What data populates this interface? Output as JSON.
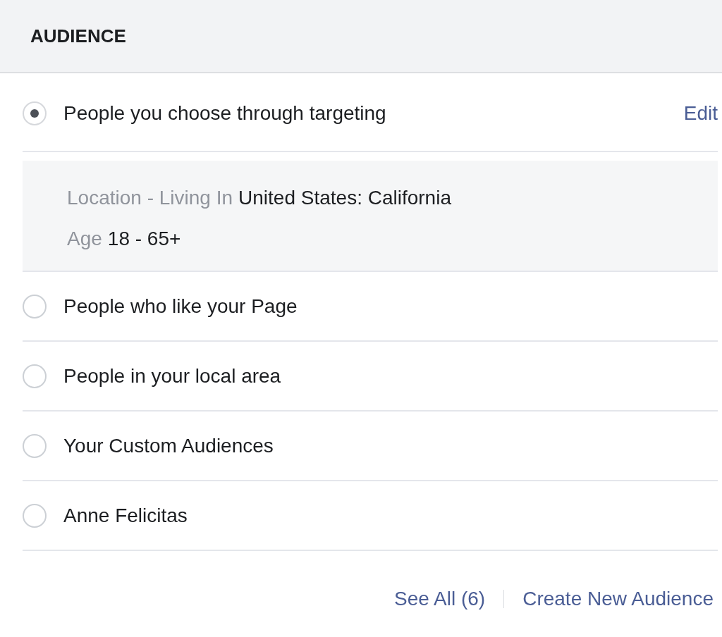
{
  "header": {
    "title": "AUDIENCE"
  },
  "options": [
    {
      "label": "People you choose through targeting",
      "selected": true,
      "action": "Edit",
      "details": [
        {
          "label": "Location - Living In",
          "value": "United States: California"
        },
        {
          "label": "Age",
          "value": "18 - 65+"
        }
      ]
    },
    {
      "label": "People who like your Page",
      "selected": false
    },
    {
      "label": "People in your local area",
      "selected": false
    },
    {
      "label": "Your Custom Audiences",
      "selected": false
    },
    {
      "label": "Anne Felicitas",
      "selected": false
    }
  ],
  "footer_links": [
    "See All (6)",
    "Create New Audience"
  ]
}
